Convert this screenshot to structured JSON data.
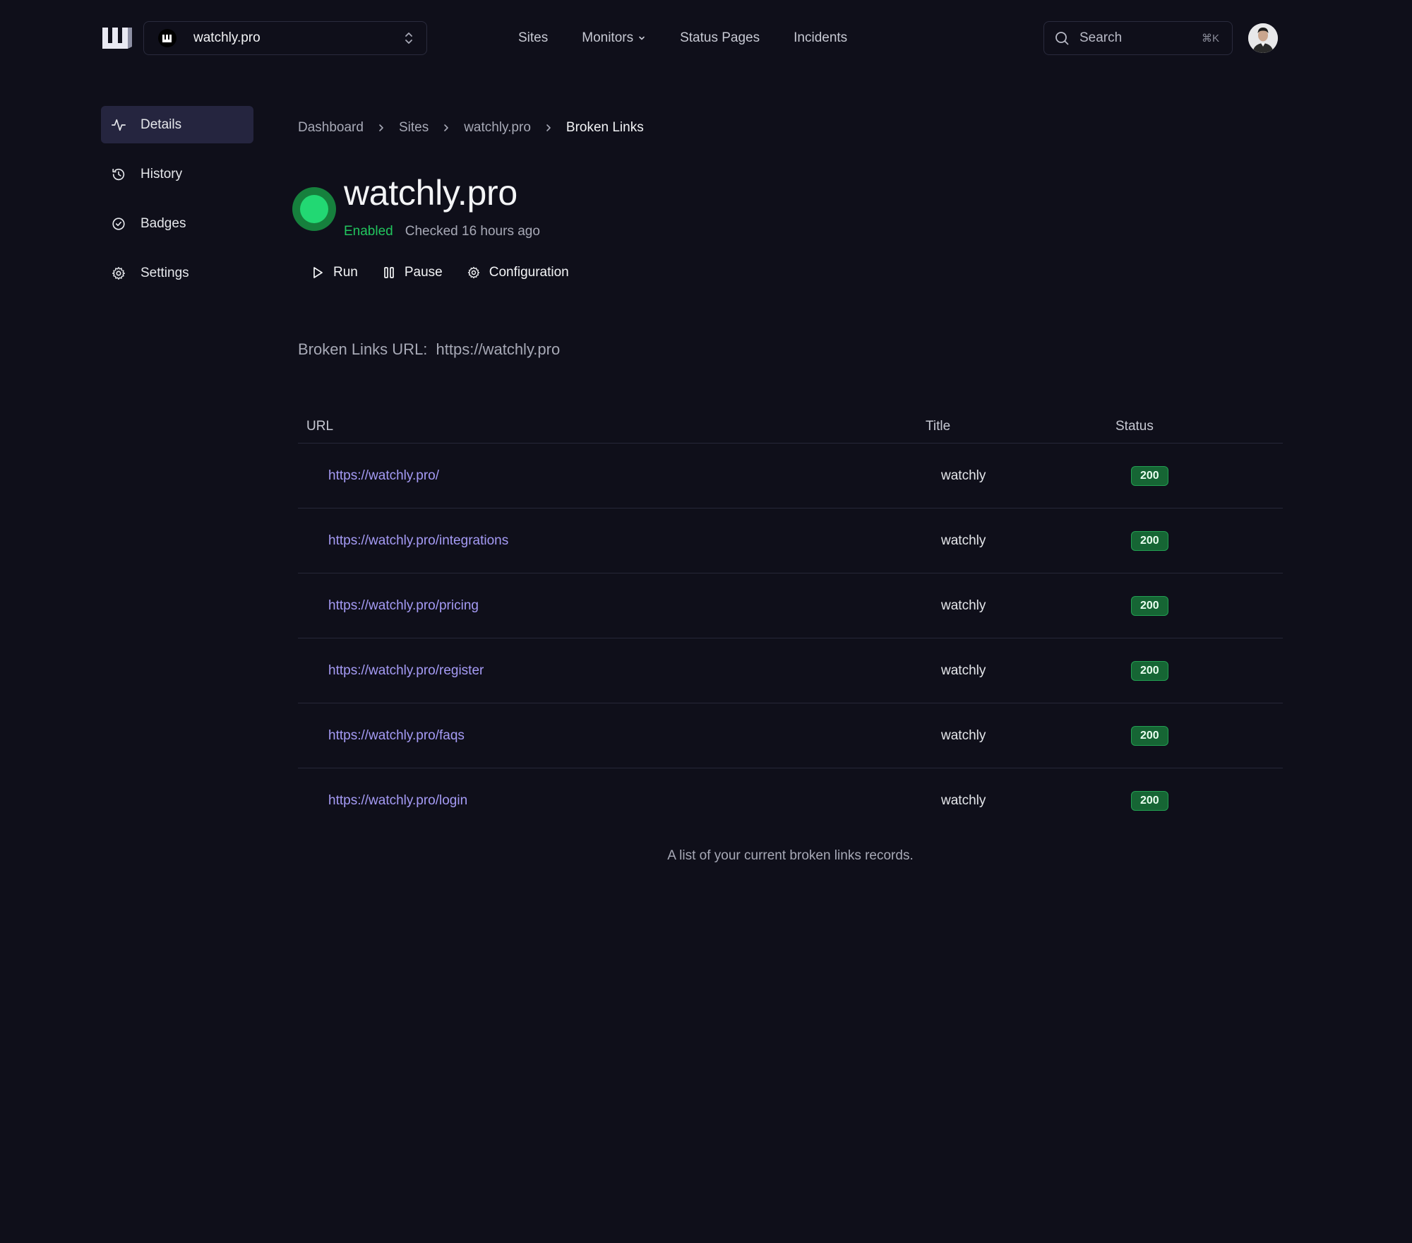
{
  "header": {
    "site_switcher": {
      "name": "watchly.pro",
      "avatar_letter": "w"
    },
    "nav": [
      {
        "label": "Sites"
      },
      {
        "label": "Monitors",
        "has_dropdown": true
      },
      {
        "label": "Status Pages"
      },
      {
        "label": "Incidents"
      }
    ],
    "search": {
      "label": "Search",
      "shortcut": "⌘K"
    }
  },
  "sidebar": {
    "items": [
      {
        "label": "Details",
        "icon": "activity-icon",
        "active": true
      },
      {
        "label": "History",
        "icon": "history-icon"
      },
      {
        "label": "Badges",
        "icon": "badge-check-icon"
      },
      {
        "label": "Settings",
        "icon": "gear-icon"
      }
    ]
  },
  "breadcrumb": [
    "Dashboard",
    "Sites",
    "watchly.pro",
    "Broken Links"
  ],
  "site": {
    "title": "watchly.pro",
    "status": "Enabled",
    "checked": "Checked 16 hours ago",
    "status_color": "#22c55e"
  },
  "actions": {
    "run": "Run",
    "pause": "Pause",
    "configuration": "Configuration"
  },
  "broken_links": {
    "label": "Broken Links URL:",
    "url": "https://watchly.pro"
  },
  "table": {
    "headers": {
      "url": "URL",
      "title": "Title",
      "status": "Status"
    },
    "rows": [
      {
        "url": "https://watchly.pro/",
        "title": "watchly",
        "status": "200"
      },
      {
        "url": "https://watchly.pro/integrations",
        "title": "watchly",
        "status": "200"
      },
      {
        "url": "https://watchly.pro/pricing",
        "title": "watchly",
        "status": "200"
      },
      {
        "url": "https://watchly.pro/register",
        "title": "watchly",
        "status": "200"
      },
      {
        "url": "https://watchly.pro/faqs",
        "title": "watchly",
        "status": "200"
      },
      {
        "url": "https://watchly.pro/login",
        "title": "watchly",
        "status": "200"
      }
    ],
    "caption": "A list of your current broken links records."
  },
  "colors": {
    "background": "#0f0f1a",
    "link": "#a59bf5",
    "badge_green": "#166534",
    "active_nav": "#25253f"
  }
}
